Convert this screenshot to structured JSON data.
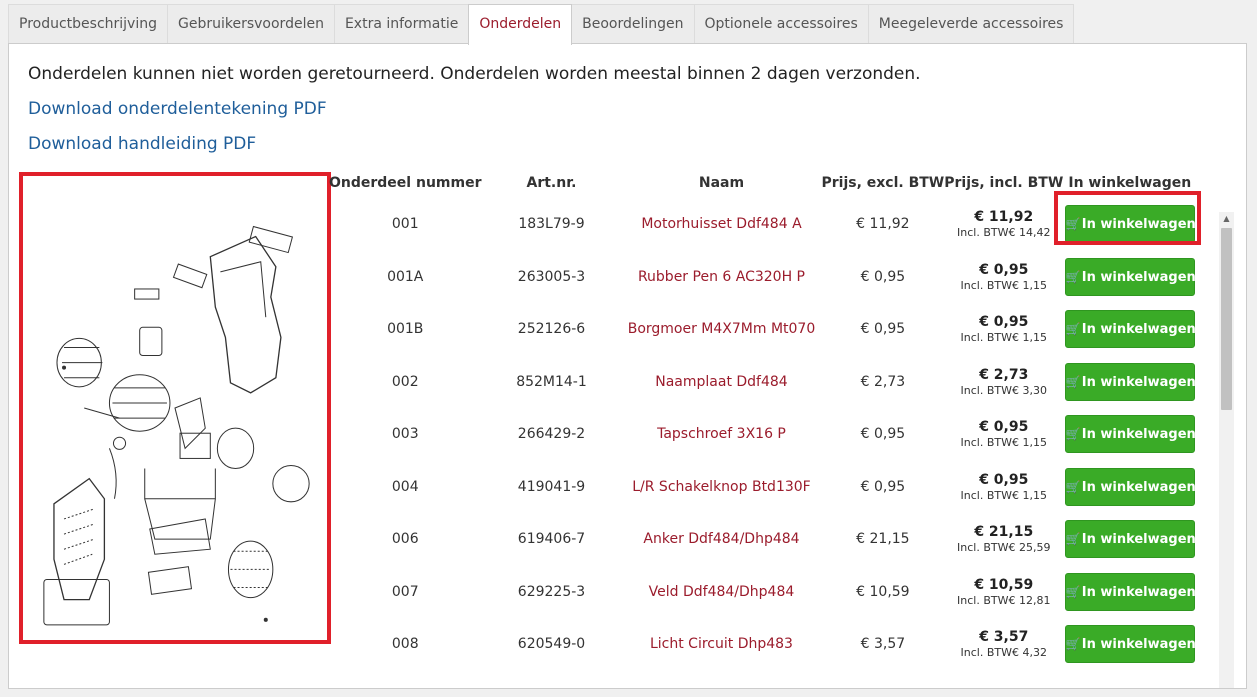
{
  "tabs": [
    {
      "label": "Productbeschrijving"
    },
    {
      "label": "Gebruikersvoordelen"
    },
    {
      "label": "Extra informatie"
    },
    {
      "label": "Onderdelen",
      "active": true
    },
    {
      "label": "Beoordelingen"
    },
    {
      "label": "Optionele accessoires"
    },
    {
      "label": "Meegeleverde accessoires"
    }
  ],
  "notice": "Onderdelen kunnen niet worden geretourneerd. Onderdelen worden meestal binnen 2 dagen verzonden.",
  "downloads": {
    "drawing": "Download onderdelentekening PDF",
    "manual": "Download handleiding PDF"
  },
  "table": {
    "headers": {
      "number": "Onderdeel nummer",
      "art": "Art.nr.",
      "name": "Naam",
      "excl": "Prijs, excl. BTW",
      "incl": "Prijs, incl. BTW",
      "cart": "In winkelwagen"
    },
    "rows": [
      {
        "number": "001",
        "art": "183L79-9",
        "name": "Motorhuisset Ddf484 A",
        "excl": "€ 11,92",
        "incl": "€ 11,92",
        "incl_label": "Incl. BTW",
        "incl_btw": "€ 14,42",
        "cart": "In winkelwagen"
      },
      {
        "number": "001A",
        "art": "263005-3",
        "name": "Rubber Pen 6 AC320H P",
        "excl": "€ 0,95",
        "incl": "€ 0,95",
        "incl_label": "Incl. BTW",
        "incl_btw": "€ 1,15",
        "cart": "In winkelwagen"
      },
      {
        "number": "001B",
        "art": "252126-6",
        "name": "Borgmoer M4X7Mm Mt070",
        "excl": "€ 0,95",
        "incl": "€ 0,95",
        "incl_label": "Incl. BTW",
        "incl_btw": "€ 1,15",
        "cart": "In winkelwagen"
      },
      {
        "number": "002",
        "art": "852M14-1",
        "name": "Naamplaat Ddf484",
        "excl": "€ 2,73",
        "incl": "€ 2,73",
        "incl_label": "Incl. BTW",
        "incl_btw": "€ 3,30",
        "cart": "In winkelwagen"
      },
      {
        "number": "003",
        "art": "266429-2",
        "name": "Tapschroef 3X16 P",
        "excl": "€ 0,95",
        "incl": "€ 0,95",
        "incl_label": "Incl. BTW",
        "incl_btw": "€ 1,15",
        "cart": "In winkelwagen"
      },
      {
        "number": "004",
        "art": "419041-9",
        "name": "L/R Schakelknop Btd130F",
        "excl": "€ 0,95",
        "incl": "€ 0,95",
        "incl_label": "Incl. BTW",
        "incl_btw": "€ 1,15",
        "cart": "In winkelwagen"
      },
      {
        "number": "006",
        "art": "619406-7",
        "name": "Anker Ddf484/Dhp484",
        "excl": "€ 21,15",
        "incl": "€ 21,15",
        "incl_label": "Incl. BTW",
        "incl_btw": "€ 25,59",
        "cart": "In winkelwagen"
      },
      {
        "number": "007",
        "art": "629225-3",
        "name": "Veld Ddf484/Dhp484",
        "excl": "€ 10,59",
        "incl": "€ 10,59",
        "incl_label": "Incl. BTW",
        "incl_btw": "€ 12,81",
        "cart": "In winkelwagen"
      },
      {
        "number": "008",
        "art": "620549-0",
        "name": "Licht Circuit Dhp483",
        "excl": "€ 3,57",
        "incl": "€ 3,57",
        "incl_label": "Incl. BTW",
        "incl_btw": "€ 4,32",
        "cart": "In winkelwagen"
      }
    ]
  },
  "icons": {
    "cart": "cart-icon",
    "scroll_up": "arrow-up-icon",
    "scroll_down": "arrow-down-icon"
  },
  "colors": {
    "accent": "#9b1c2c",
    "link": "#1f5e9a",
    "button": "#3aab27",
    "highlight": "#e0202a"
  }
}
